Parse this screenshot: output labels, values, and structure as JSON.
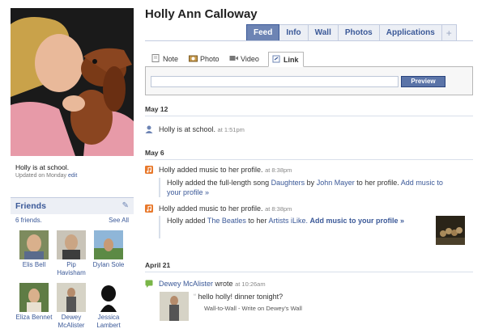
{
  "profile": {
    "name": "Holly Ann Calloway",
    "status": "Holly is at school.",
    "updated_prefix": "Updated on Monday",
    "updated_edit": "edit"
  },
  "tabs": [
    {
      "label": "Feed",
      "active": true
    },
    {
      "label": "Info"
    },
    {
      "label": "Wall"
    },
    {
      "label": "Photos"
    },
    {
      "label": "Applications"
    },
    {
      "label": "+"
    }
  ],
  "composer": {
    "tabs": [
      {
        "label": "Note",
        "icon": "note-icon"
      },
      {
        "label": "Photo",
        "icon": "camera-icon"
      },
      {
        "label": "Video",
        "icon": "video-icon"
      },
      {
        "label": "Link",
        "icon": "link-icon",
        "active": true
      }
    ],
    "link_value": "",
    "preview_label": "Preview"
  },
  "friends": {
    "title": "Friends",
    "count_text": "6 friends.",
    "see_all": "See All",
    "items": [
      {
        "name": "Elis Bell"
      },
      {
        "name": "Pip Havisham"
      },
      {
        "name": "Dylan Sole"
      },
      {
        "name": "Eliza Bennet"
      },
      {
        "name": "Dewey McAlister"
      },
      {
        "name": "Jessica Lambert"
      }
    ]
  },
  "feed": {
    "groups": [
      {
        "date": "May 12",
        "stories": [
          {
            "icon": "person-icon",
            "text": "Holly is at school.",
            "time": "at 1:51pm"
          }
        ]
      },
      {
        "date": "May 6",
        "stories": [
          {
            "icon": "music-icon",
            "text": "Holly added music to her profile.",
            "time": "at 8:38pm",
            "detail": {
              "pre": "Holly added the full-length song",
              "song": "Daughters",
              "by": "by",
              "artist": "John Mayer",
              "post": "to her profile.",
              "action1": "Add",
              "action2": "music to your profile »"
            }
          },
          {
            "icon": "music-icon",
            "text": "Holly added music to her profile.",
            "time": "at 8:38pm",
            "detail": {
              "pre": "Holly added",
              "artist": "The Beatles",
              "mid": "to her",
              "list": "Artists iLike.",
              "action": "Add music to your profile »"
            }
          }
        ]
      },
      {
        "date": "April 21",
        "stories": [
          {
            "icon": "wall-post-icon",
            "author": "Dewey McAlister",
            "verb": "wrote",
            "time": "at 10:26am",
            "quote": "hello holly! dinner tonight?",
            "footer": "Wall-to-Wall - Write on Dewey's Wall"
          }
        ]
      }
    ]
  },
  "colors": {
    "brand": "#3b5998",
    "tab_active": "#6d84b4",
    "music_icon": "#e8792c"
  }
}
